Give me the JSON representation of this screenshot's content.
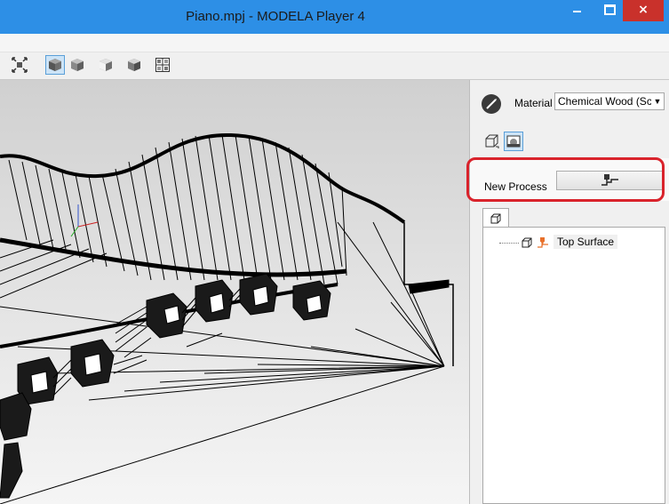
{
  "window": {
    "title": "Piano.mpj - MODELA Player 4",
    "close_glyph": "×"
  },
  "toolbar": {
    "buttons": [
      {
        "icon": "fit-view-icon",
        "active": false
      },
      {
        "icon": "iso-view-icon",
        "active": true
      },
      {
        "icon": "front-view-icon",
        "active": false
      },
      {
        "icon": "side-view-icon",
        "active": false
      },
      {
        "icon": "back-view-icon",
        "active": false
      },
      {
        "icon": "multi-view-icon",
        "active": false
      }
    ]
  },
  "panel": {
    "material_label": "Material",
    "material_value": "Chemical Wood (Sc",
    "new_process_label": "New Process",
    "tree": {
      "items": [
        {
          "label": "Top Surface"
        }
      ]
    }
  },
  "colors": {
    "titlebar": "#2d8fe6",
    "close_button": "#c9312b",
    "highlight": "#d9232c",
    "process_icon": "#e8702a"
  }
}
